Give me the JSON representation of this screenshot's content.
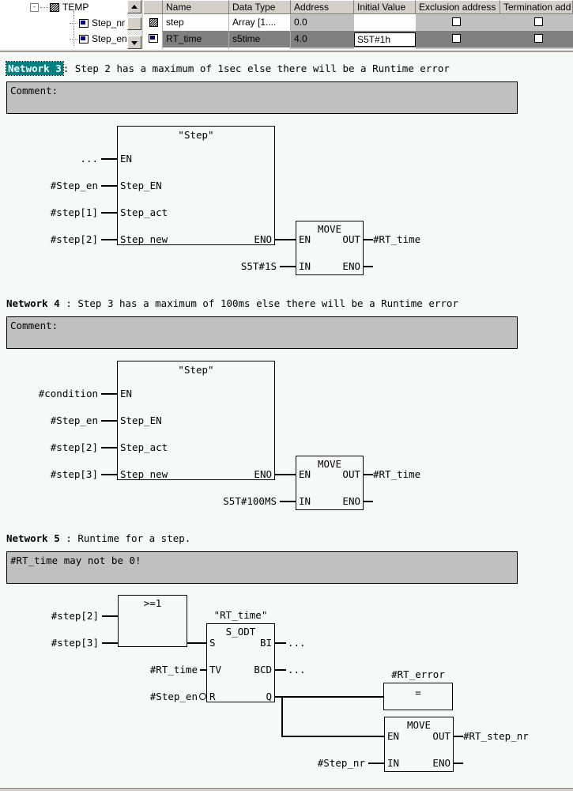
{
  "tree": {
    "root": {
      "label": "TEMP",
      "icon": "struct-icon",
      "expander": "-"
    },
    "children": [
      {
        "label": "Step_nr",
        "icon": "variable-icon"
      },
      {
        "label": "Step_en",
        "icon": "variable-icon"
      }
    ],
    "scrollbar": {
      "up_icon": "scroll-up-arrow-icon",
      "down_icon": "scroll-down-arrow-icon"
    }
  },
  "decl_table": {
    "columns": [
      "Name",
      "Data Type",
      "Address",
      "Initial Value",
      "Exclusion address",
      "Termination add"
    ],
    "rows": [
      {
        "icon": "array-variable-icon",
        "name": "step",
        "data_type": "Array [1....",
        "address": "0.0",
        "initial_value": "",
        "exclusion_address": "",
        "termination_address": "",
        "selected": false,
        "editing": false
      },
      {
        "icon": "variable-icon",
        "name": "RT_time",
        "data_type": "s5time",
        "address": "4.0",
        "initial_value": "S5T#1h",
        "exclusion_address": "",
        "termination_address": "",
        "selected": true,
        "editing": true
      }
    ]
  },
  "colors": {
    "background": "#f5faf6",
    "selection": "#008080",
    "comment_box": "#c0c0c0",
    "row_selected": "#808080",
    "chrome": "#d4d0c8"
  },
  "networks": [
    {
      "label": "Network 3",
      "selected": true,
      "separator": ":",
      "title": "Step 2 has a maximum of 1sec else there will be a Runtime error",
      "comment": "Comment:",
      "blocks": {
        "step": {
          "name": "\"Step\"",
          "inputs": [
            {
              "pin": "EN",
              "operand": "..."
            },
            {
              "pin": "Step_EN",
              "operand": "#Step_en"
            },
            {
              "pin": "Step_act",
              "operand": "#step[1]"
            },
            {
              "pin": "Step_new",
              "operand": "#step[2]"
            }
          ],
          "outputs": [
            {
              "pin": "ENO",
              "operand": ""
            }
          ]
        },
        "move": {
          "name": "MOVE",
          "inputs": [
            {
              "pin": "EN",
              "operand": ""
            },
            {
              "pin": "IN",
              "operand": "S5T#1S"
            }
          ],
          "outputs": [
            {
              "pin": "OUT",
              "operand": "#RT_time"
            },
            {
              "pin": "ENO",
              "operand": ""
            }
          ]
        }
      }
    },
    {
      "label": "Network 4",
      "selected": false,
      "separator": ":",
      "title": "Step 3 has a maximum of 100ms else there will be a Runtime error",
      "comment": "Comment:",
      "blocks": {
        "step": {
          "name": "\"Step\"",
          "inputs": [
            {
              "pin": "EN",
              "operand": "#condition"
            },
            {
              "pin": "Step_EN",
              "operand": "#Step_en"
            },
            {
              "pin": "Step_act",
              "operand": "#step[2]"
            },
            {
              "pin": "Step_new",
              "operand": "#step[3]"
            }
          ],
          "outputs": [
            {
              "pin": "ENO",
              "operand": ""
            }
          ]
        },
        "move": {
          "name": "MOVE",
          "inputs": [
            {
              "pin": "EN",
              "operand": ""
            },
            {
              "pin": "IN",
              "operand": "S5T#100MS"
            }
          ],
          "outputs": [
            {
              "pin": "OUT",
              "operand": "#RT_time"
            },
            {
              "pin": "ENO",
              "operand": ""
            }
          ]
        }
      }
    },
    {
      "label": "Network 5",
      "selected": false,
      "separator": ":",
      "title": "Runtime for a step.",
      "comment": "#RT_time may not be 0!",
      "blocks": {
        "or": {
          "name": ">=1",
          "inputs": [
            {
              "pin": "",
              "operand": "#step[2]"
            },
            {
              "pin": "",
              "operand": "#step[3]"
            }
          ]
        },
        "timer": {
          "instance": "\"RT_time\"",
          "name": "S_ODT",
          "inputs": [
            {
              "pin": "S",
              "operand": ""
            },
            {
              "pin": "TV",
              "operand": "#RT_time"
            },
            {
              "pin": "R",
              "operand": "#Step_en",
              "negated": true
            }
          ],
          "outputs": [
            {
              "pin": "BI",
              "operand": "..."
            },
            {
              "pin": "BCD",
              "operand": "..."
            },
            {
              "pin": "Q",
              "operand": ""
            }
          ]
        },
        "coil": {
          "name": "#RT_error",
          "symbol": "="
        },
        "move": {
          "name": "MOVE",
          "inputs": [
            {
              "pin": "EN",
              "operand": ""
            },
            {
              "pin": "IN",
              "operand": "#Step_nr"
            }
          ],
          "outputs": [
            {
              "pin": "OUT",
              "operand": "#RT_step_nr"
            },
            {
              "pin": "ENO",
              "operand": ""
            }
          ]
        }
      }
    }
  ]
}
